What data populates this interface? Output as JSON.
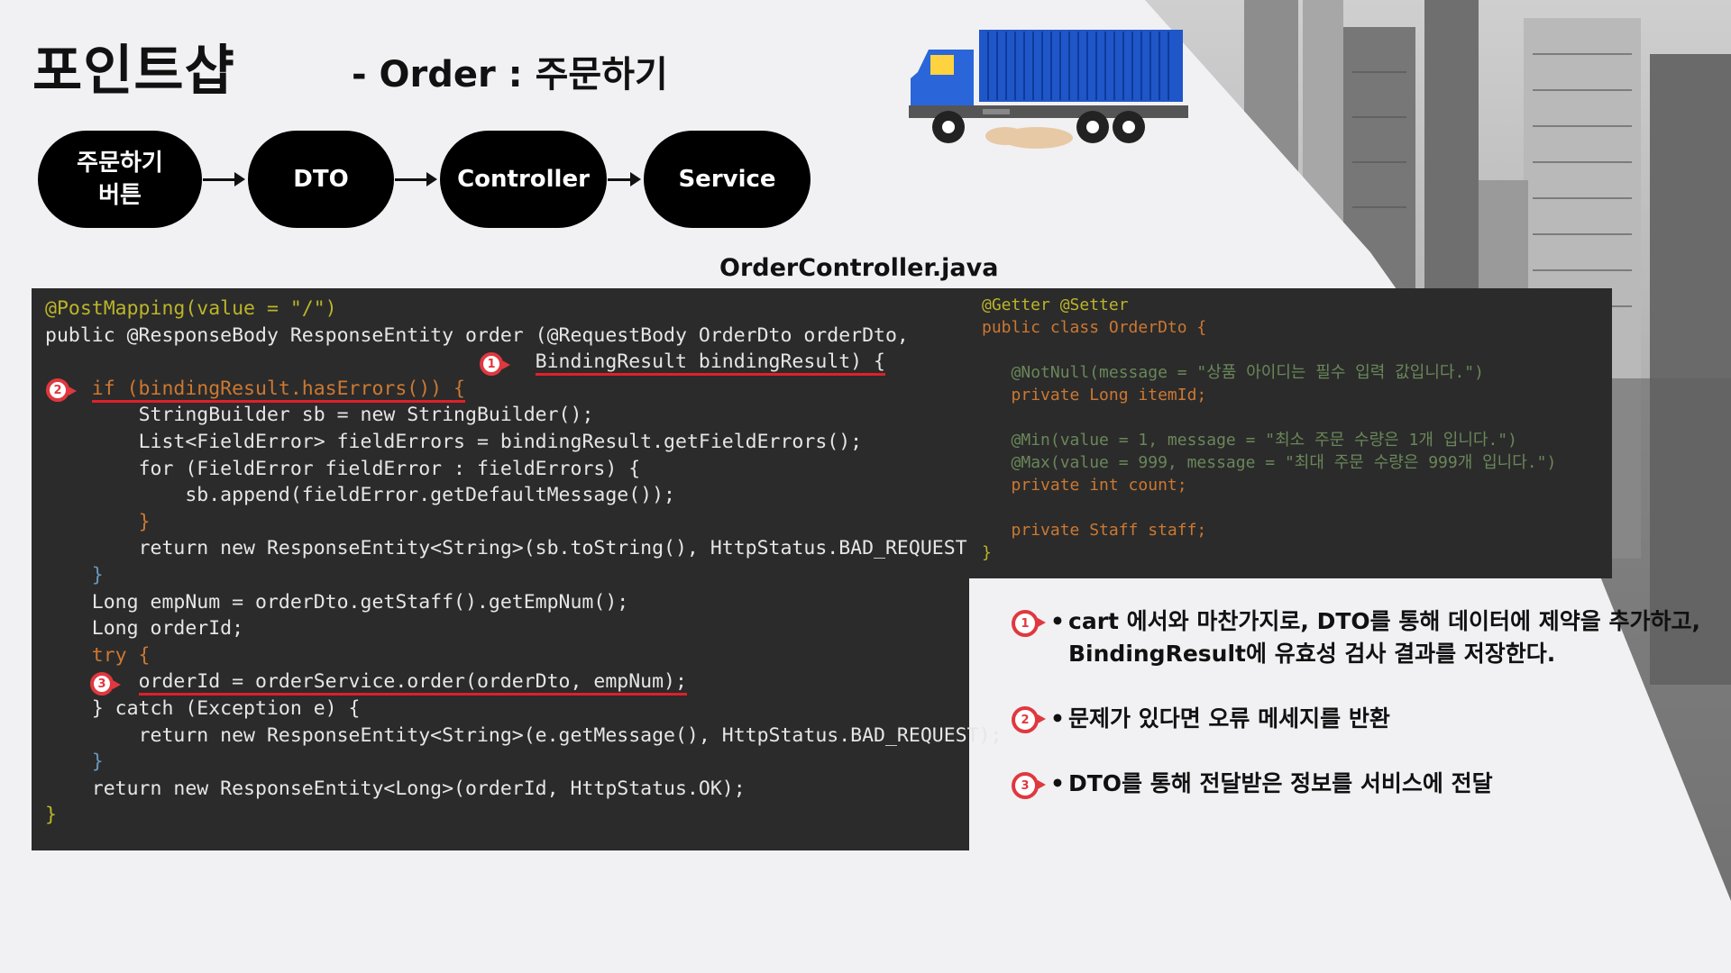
{
  "title": "포인트샵",
  "subtitle": "- Order : 주문하기",
  "flow": [
    {
      "label": "주문하기\n버튼"
    },
    {
      "label": "DTO"
    },
    {
      "label": "Controller"
    },
    {
      "label": "Service"
    }
  ],
  "file_label": "OrderController.java",
  "badges": [
    "1",
    "2",
    "3"
  ],
  "controller_code": {
    "l1": "@PostMapping(value = \"/\")",
    "l2a": "public @ResponseBody ResponseEntity order (@RequestBody OrderDto orderDto,",
    "l3": "BindingResult bindingResult) {",
    "l4": "if (bindingResult.hasErrors()) {",
    "l5": "StringBuilder sb = new StringBuilder();",
    "l6": "List<FieldError> fieldErrors = bindingResult.getFieldErrors();",
    "l7": "for (FieldError fieldError : fieldErrors) {",
    "l8": "sb.append(fieldError.getDefaultMessage());",
    "l9": "}",
    "l10": "return new ResponseEntity<String>(sb.toString(), HttpStatus.BAD_REQUEST);",
    "l11": "}",
    "l12": "Long empNum = orderDto.getStaff().getEmpNum();",
    "l13": "Long orderId;",
    "l14": "try {",
    "l15": "orderId = orderService.order(orderDto, empNum);",
    "l16": "} catch (Exception e) {",
    "l17": "return new ResponseEntity<String>(e.getMessage(), HttpStatus.BAD_REQUEST);",
    "l18": "}",
    "l19": "return new ResponseEntity<Long>(orderId, HttpStatus.OK);",
    "l20": "}"
  },
  "dto_code": {
    "l1": "@Getter @Setter",
    "l2": "public class OrderDto {",
    "l3": "@NotNull(message = \"상품 아이디는 필수 입력 값입니다.\")",
    "l4": "private Long itemId;",
    "l5": "@Min(value = 1, message = \"최소 주문 수량은 1개 입니다.\")",
    "l6": "@Max(value = 999, message = \"최대 주문 수량은 999개 입니다.\")",
    "l7": "private int count;",
    "l8": "private Staff staff;",
    "l9": "}"
  },
  "explanations": [
    {
      "bullet": "•",
      "line1": "cart 에서와 마찬가지로, DTO를 통해 데이터에 제약을 추가하고,",
      "line2": "BindingResult에 유효성 검사 결과를 저장한다."
    },
    {
      "bullet": "•",
      "line1": "문제가 있다면 오류 메세지를 반환"
    },
    {
      "bullet": "•",
      "line1": "DTO를 통해 전달받은 정보를 서비스에 전달"
    }
  ],
  "colors": {
    "accent_red": "#e0383f",
    "code_bg": "#2b2b2b",
    "page_bg": "#f1f1f3",
    "node_bg": "#000000",
    "truck_container": "#1f56c8",
    "truck_cab": "#2a66d9"
  },
  "images": [
    "city-skyline-photo",
    "cargo-truck-illustration"
  ]
}
